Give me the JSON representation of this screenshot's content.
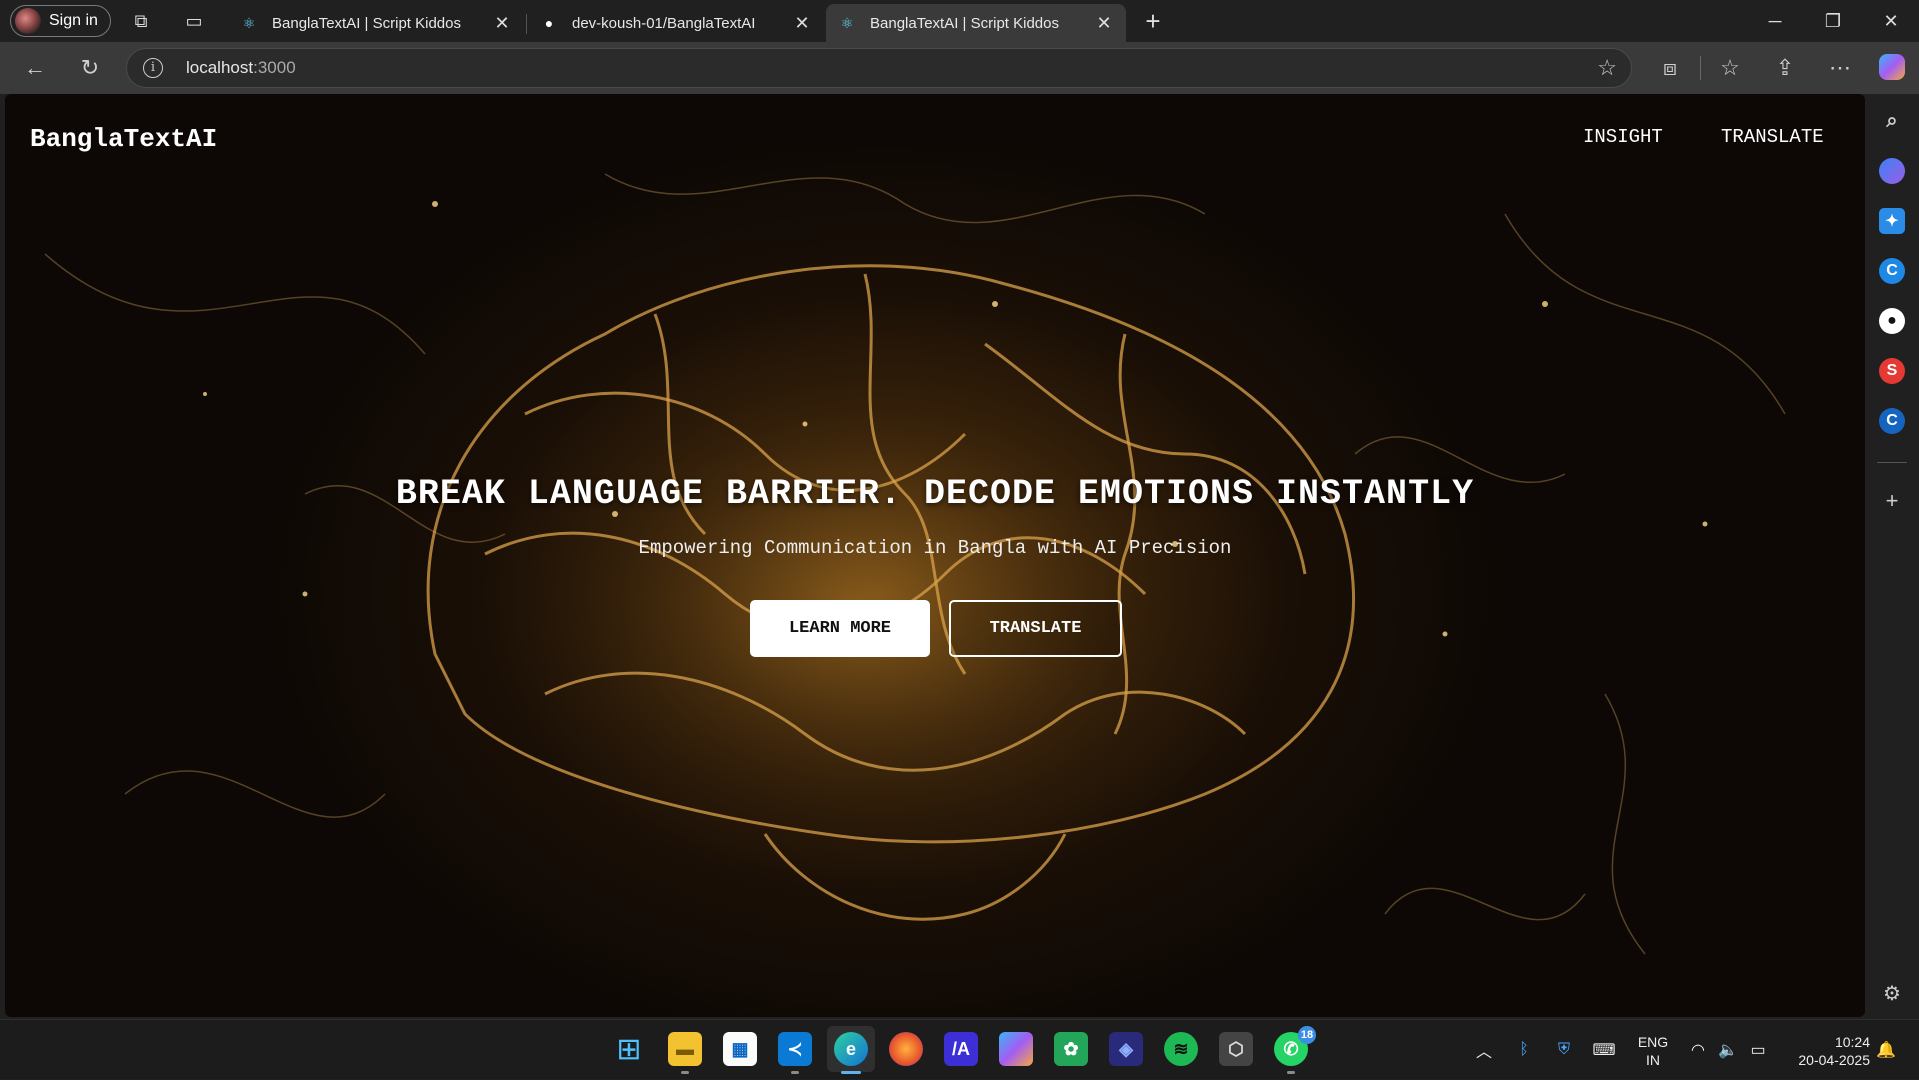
{
  "browser": {
    "signin_label": "Sign in",
    "tabs": [
      {
        "title": "BanglaTextAI | Script Kiddos",
        "active": false
      },
      {
        "title": "dev-koush-01/BanglaTextAI",
        "active": false
      },
      {
        "title": "BanglaTextAI | Script Kiddos",
        "active": true
      }
    ],
    "url_host": "localhost",
    "url_port": ":3000"
  },
  "site": {
    "logo": "BanglaTextAI",
    "nav": [
      "INSIGHT",
      "TRANSLATE"
    ],
    "hero_title": "BREAK LANGUAGE BARRIER. DECODE EMOTIONS INSTANTLY",
    "hero_subtitle": "Empowering Communication in Bangla with AI Precision",
    "cta_primary": "LEARN MORE",
    "cta_secondary": "TRANSLATE"
  },
  "taskbar": {
    "whatsapp_badge": "18",
    "lang_line1": "ENG",
    "lang_line2": "IN",
    "time": "10:24",
    "date": "20-04-2025"
  },
  "colors": {
    "browser_chrome": "#202020",
    "toolbar": "#3a3a3a",
    "hero_glow": "#6b4412",
    "accent_blue": "#5fb2f2"
  }
}
